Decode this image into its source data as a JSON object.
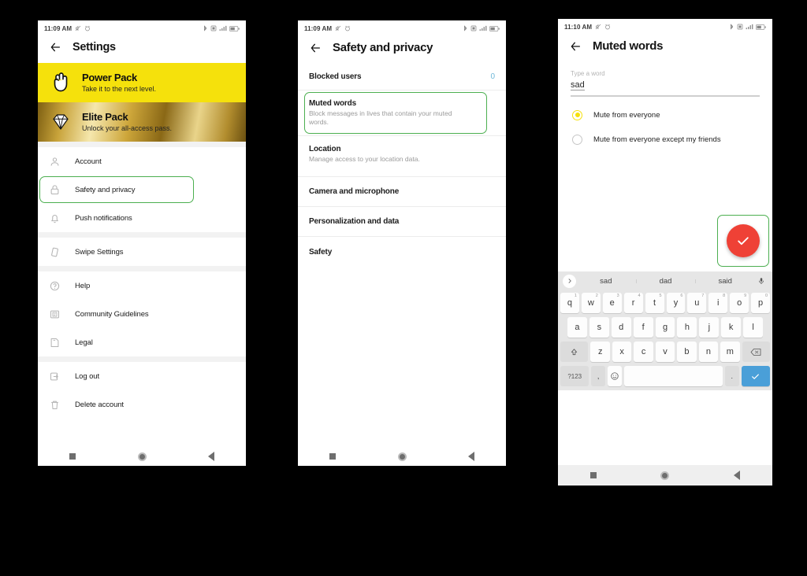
{
  "screens": {
    "settings": {
      "status": {
        "time": "11:09 AM",
        "icons": [
          "mute-icon",
          "alarm-icon",
          "bluetooth-icon",
          "sim-icon",
          "signal-icon",
          "battery-icon"
        ]
      },
      "title": "Settings",
      "promos": [
        {
          "title": "Power Pack",
          "subtitle": "Take it to the next level.",
          "icon": "rock-hand-icon",
          "color": "#F5E10C"
        },
        {
          "title": "Elite Pack",
          "subtitle": "Unlock your all-access pass.",
          "icon": "diamond-icon",
          "color": "#c8a33a"
        }
      ],
      "groups": [
        {
          "items": [
            {
              "label": "Account",
              "icon": "person-icon",
              "highlighted": false
            },
            {
              "label": "Safety and privacy",
              "icon": "lock-icon",
              "highlighted": true
            },
            {
              "label": "Push notifications",
              "icon": "bell-icon",
              "highlighted": false
            }
          ]
        },
        {
          "items": [
            {
              "label": "Swipe Settings",
              "icon": "swipe-icon",
              "highlighted": false
            }
          ]
        },
        {
          "items": [
            {
              "label": "Help",
              "icon": "question-icon",
              "highlighted": false
            },
            {
              "label": "Community Guidelines",
              "icon": "guidelines-icon",
              "highlighted": false
            },
            {
              "label": "Legal",
              "icon": "legal-icon",
              "highlighted": false
            }
          ]
        },
        {
          "items": [
            {
              "label": "Log out",
              "icon": "logout-icon",
              "highlighted": false
            },
            {
              "label": "Delete account",
              "icon": "trash-icon",
              "highlighted": false
            }
          ]
        }
      ]
    },
    "safety": {
      "status": {
        "time": "11:09 AM"
      },
      "title": "Safety and privacy",
      "items": [
        {
          "title": "Blocked users",
          "subtitle": "",
          "count": "0",
          "highlighted": false
        },
        {
          "title": "Muted words",
          "subtitle": "Block messages in lives that contain your muted words.",
          "count": "",
          "highlighted": true
        },
        {
          "title": "Location",
          "subtitle": "Manage access to your location data.",
          "count": "",
          "highlighted": false
        },
        {
          "title": "Camera and microphone",
          "subtitle": "",
          "count": "",
          "highlighted": false
        },
        {
          "title": "Personalization and data",
          "subtitle": "",
          "count": "",
          "highlighted": false
        },
        {
          "title": "Safety",
          "subtitle": "",
          "count": "",
          "highlighted": false
        }
      ]
    },
    "muted": {
      "status": {
        "time": "11:10 AM"
      },
      "title": "Muted words",
      "field": {
        "label": "Type a word",
        "value": "sad",
        "placeholder": "Type a word"
      },
      "options": [
        {
          "label": "Mute from everyone",
          "selected": true
        },
        {
          "label": "Mute from everyone except my friends",
          "selected": false
        }
      ],
      "confirm_button": {
        "icon": "check-icon",
        "color": "#ef4136",
        "highlighted": true
      },
      "keyboard": {
        "suggestions": [
          "sad",
          "dad",
          "said"
        ],
        "expand_icon": "chevron-right-icon",
        "mic_icon": "microphone-icon",
        "row1": [
          {
            "k": "q",
            "n": "1"
          },
          {
            "k": "w",
            "n": "2"
          },
          {
            "k": "e",
            "n": "3"
          },
          {
            "k": "r",
            "n": "4"
          },
          {
            "k": "t",
            "n": "5"
          },
          {
            "k": "y",
            "n": "6"
          },
          {
            "k": "u",
            "n": "7"
          },
          {
            "k": "i",
            "n": "8"
          },
          {
            "k": "o",
            "n": "9"
          },
          {
            "k": "p",
            "n": "0"
          }
        ],
        "row2": [
          "a",
          "s",
          "d",
          "f",
          "g",
          "h",
          "j",
          "k",
          "l"
        ],
        "row3": [
          "z",
          "x",
          "c",
          "v",
          "b",
          "n",
          "m"
        ],
        "shift_key": "shift-icon",
        "backspace_key": "backspace-icon",
        "symbols_key": "?123",
        "comma_key": ",",
        "emoji_key": "emoji-icon",
        "space_key": "",
        "period_key": ".",
        "enter_key": "check-icon"
      }
    }
  },
  "navbar": {
    "recents": "recents-square",
    "home": "home-circle",
    "back": "back-triangle"
  },
  "colors": {
    "accent_yellow": "#F5E10C",
    "highlight_green": "#4caf50",
    "fab_red": "#ef4136",
    "enter_blue": "#4a9fd8",
    "count_blue": "#6fb8d8"
  }
}
